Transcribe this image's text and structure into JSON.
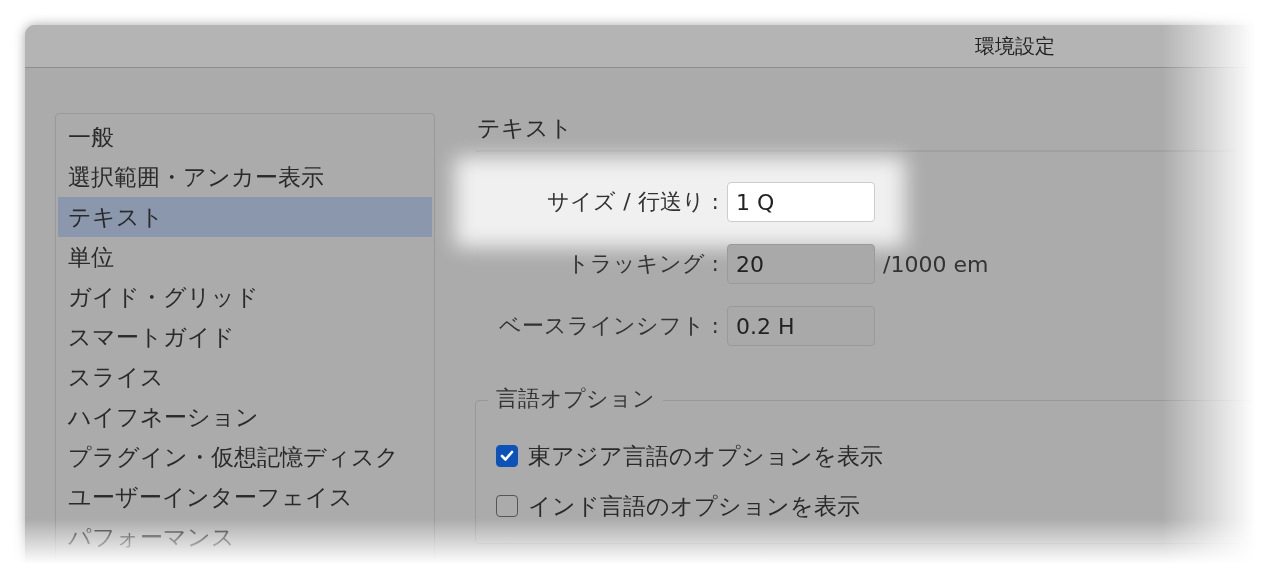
{
  "window": {
    "title": "環境設定"
  },
  "sidebar": {
    "items": [
      {
        "label": "一般",
        "selected": false
      },
      {
        "label": "選択範囲・アンカー表示",
        "selected": false
      },
      {
        "label": "テキスト",
        "selected": true
      },
      {
        "label": "単位",
        "selected": false
      },
      {
        "label": "ガイド・グリッド",
        "selected": false
      },
      {
        "label": "スマートガイド",
        "selected": false
      },
      {
        "label": "スライス",
        "selected": false
      },
      {
        "label": "ハイフネーション",
        "selected": false
      },
      {
        "label": "プラグイン・仮想記憶ディスク",
        "selected": false
      },
      {
        "label": "ユーザーインターフェイス",
        "selected": false
      },
      {
        "label": "パフォーマンス",
        "selected": false
      }
    ]
  },
  "panel": {
    "heading": "テキスト",
    "fields": [
      {
        "label": "サイズ / 行送り :",
        "value": "1 Q",
        "highlighted": true
      },
      {
        "label": "トラッキング :",
        "value": "20",
        "unit": "/1000 em",
        "highlighted": false
      },
      {
        "label": "ベースラインシフト :",
        "value": "0.2 H",
        "highlighted": false
      }
    ],
    "group": {
      "title": "言語オプション",
      "options": [
        {
          "label": "東アジア言語のオプションを表示",
          "checked": true
        },
        {
          "label": "インド言語のオプションを表示",
          "checked": false
        }
      ]
    }
  }
}
